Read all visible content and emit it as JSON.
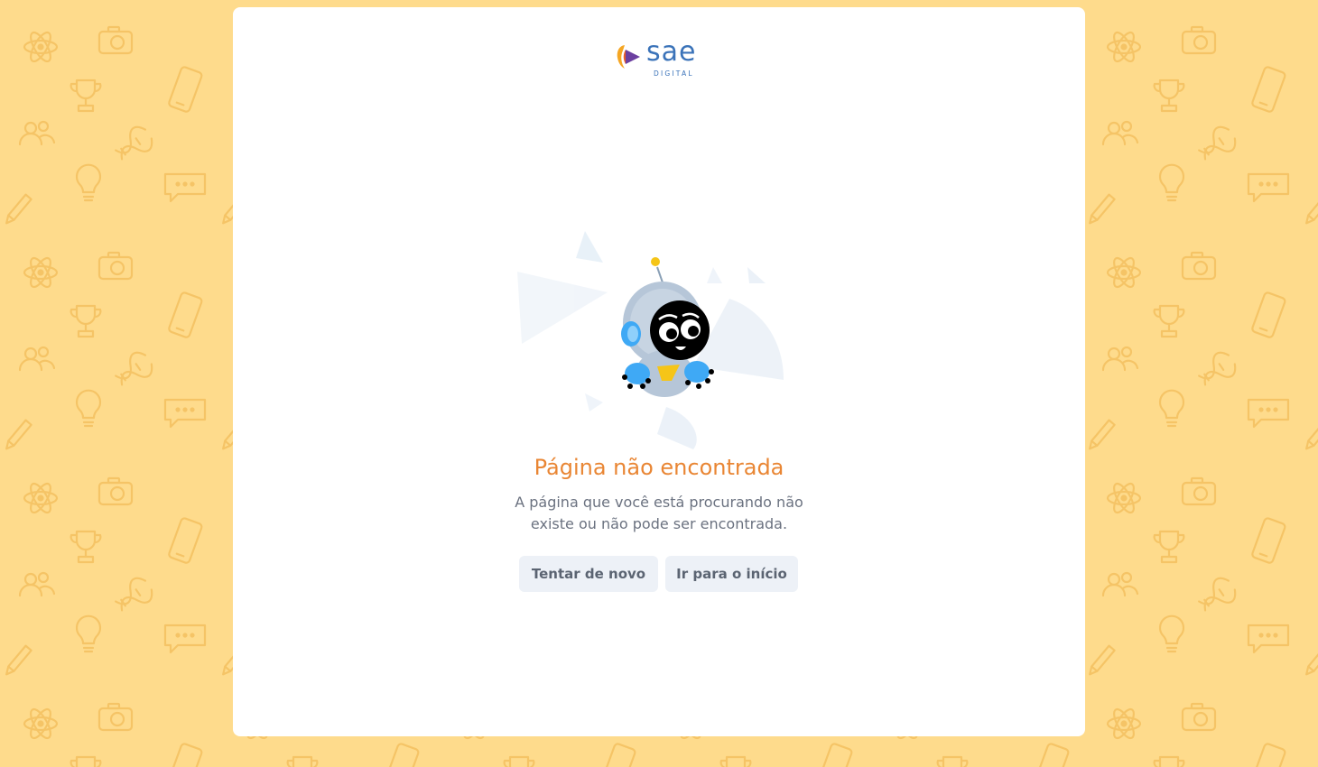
{
  "brand": {
    "name": "sae",
    "sub": "DIGITAL",
    "color": "#3b73b9",
    "accent_colors": [
      "#f5a623",
      "#6b3fa0"
    ]
  },
  "error": {
    "title": "Página não encontrada",
    "description_line1": "A página que você está procurando não",
    "description_line2": "existe ou não pode ser encontrada.",
    "title_color": "#e98634"
  },
  "actions": {
    "retry_label": "Tentar de novo",
    "home_label": "Ir para o início"
  },
  "background": {
    "color": "#fedb8c",
    "pattern_color": "#f5c466",
    "pattern_icons": [
      "atom-icon",
      "camera-icon",
      "trophy-icon",
      "phone-icon",
      "chat-bubble-icon",
      "lightbulb-icon",
      "dna-icon",
      "pencil-icon",
      "music-note-icon",
      "palette-icon",
      "globe-icon",
      "document-icon",
      "users-icon",
      "abacus-icon"
    ]
  },
  "illustration": {
    "name": "robot-mascot",
    "body_color": "#b6c6d8",
    "accent_color": "#3fa9f5",
    "antenna_color": "#f5c518"
  }
}
